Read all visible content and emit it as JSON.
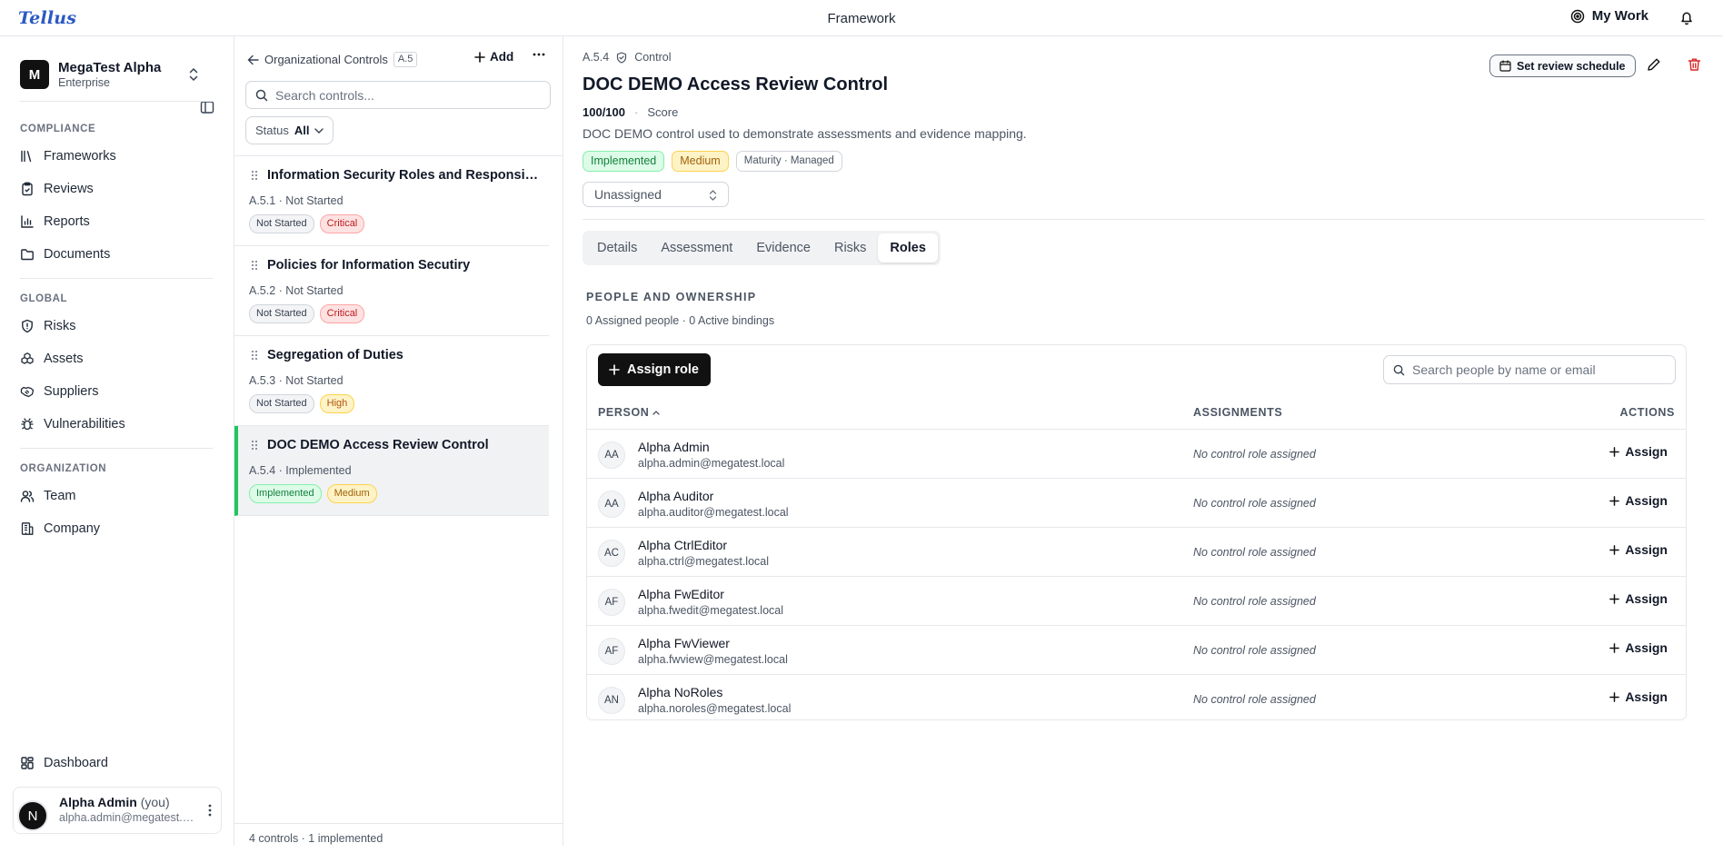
{
  "app": {
    "logo": "Tellus",
    "page_title": "Framework",
    "my_work_label": "My Work"
  },
  "sidebar": {
    "org_initial": "M",
    "org_name": "MegaTest Alpha",
    "org_plan": "Enterprise",
    "sections": [
      {
        "title": "COMPLIANCE",
        "items": [
          {
            "label": "Frameworks",
            "icon": "library-icon"
          },
          {
            "label": "Reviews",
            "icon": "clipboard-check-icon"
          },
          {
            "label": "Reports",
            "icon": "bar-chart-icon"
          },
          {
            "label": "Documents",
            "icon": "folder-icon"
          }
        ]
      },
      {
        "title": "GLOBAL",
        "items": [
          {
            "label": "Risks",
            "icon": "shield-alert-icon"
          },
          {
            "label": "Assets",
            "icon": "boxes-icon"
          },
          {
            "label": "Suppliers",
            "icon": "handshake-icon"
          },
          {
            "label": "Vulnerabilities",
            "icon": "bug-icon"
          }
        ]
      },
      {
        "title": "ORGANIZATION",
        "items": [
          {
            "label": "Team",
            "icon": "users-icon"
          },
          {
            "label": "Company",
            "icon": "building-icon"
          }
        ]
      }
    ],
    "dashboard_label": "Dashboard",
    "user": {
      "initial": "N",
      "name": "Alpha Admin",
      "you": "(you)",
      "email": "alpha.admin@megatest.local"
    }
  },
  "controls_list": {
    "back_label": "Organizational Controls",
    "code": "A.5",
    "add_label": "Add",
    "search_placeholder": "Search controls...",
    "status_label": "Status",
    "status_value": "All",
    "items": [
      {
        "title": "Information Security Roles and Responsibilities",
        "subtitle": "A.5.1 · Not Started",
        "badges": [
          {
            "text": "Not Started",
            "kind": "notstarted"
          },
          {
            "text": "Critical",
            "kind": "critical"
          }
        ],
        "active": false
      },
      {
        "title": "Policies for Information Secutiry",
        "subtitle": "A.5.2 · Not Started",
        "badges": [
          {
            "text": "Not Started",
            "kind": "notstarted"
          },
          {
            "text": "Critical",
            "kind": "critical"
          }
        ],
        "active": false
      },
      {
        "title": "Segregation of Duties",
        "subtitle": "A.5.3 · Not Started",
        "badges": [
          {
            "text": "Not Started",
            "kind": "notstarted"
          },
          {
            "text": "High",
            "kind": "high"
          }
        ],
        "active": false
      },
      {
        "title": "DOC DEMO Access Review Control",
        "subtitle": "A.5.4 · Implemented",
        "badges": [
          {
            "text": "Implemented",
            "kind": "implemented"
          },
          {
            "text": "Medium",
            "kind": "medium"
          }
        ],
        "active": true
      }
    ],
    "footer": "4 controls · 1 implemented"
  },
  "detail": {
    "code": "A.5.4",
    "type_label": "Control",
    "title": "DOC DEMO Access Review Control",
    "score_value": "100/100",
    "score_label": "Score",
    "description": "DOC DEMO control used to demonstrate assessments and evidence mapping.",
    "status_badge": "Implemented",
    "priority_badge": "Medium",
    "maturity_badge": "Maturity · Managed",
    "assignee": "Unassigned",
    "review_label": "Set review schedule",
    "tabs": [
      {
        "label": "Details",
        "active": false
      },
      {
        "label": "Assessment",
        "active": false
      },
      {
        "label": "Evidence",
        "active": false
      },
      {
        "label": "Risks",
        "active": false
      },
      {
        "label": "Roles",
        "active": true
      }
    ],
    "roles": {
      "section_title": "PEOPLE AND OWNERSHIP",
      "summary": "0 Assigned people · 0 Active bindings",
      "assign_role_label": "Assign role",
      "search_placeholder": "Search people by name or email",
      "columns": {
        "person": "PERSON",
        "assignments": "ASSIGNMENTS",
        "actions": "ACTIONS"
      },
      "people": [
        {
          "initials": "AA",
          "name": "Alpha Admin",
          "email": "alpha.admin@megatest.local",
          "assignment": "No control role assigned",
          "action": "Assign"
        },
        {
          "initials": "AA",
          "name": "Alpha Auditor",
          "email": "alpha.auditor@megatest.local",
          "assignment": "No control role assigned",
          "action": "Assign"
        },
        {
          "initials": "AC",
          "name": "Alpha CtrlEditor",
          "email": "alpha.ctrl@megatest.local",
          "assignment": "No control role assigned",
          "action": "Assign"
        },
        {
          "initials": "AF",
          "name": "Alpha FwEditor",
          "email": "alpha.fwedit@megatest.local",
          "assignment": "No control role assigned",
          "action": "Assign"
        },
        {
          "initials": "AF",
          "name": "Alpha FwViewer",
          "email": "alpha.fwview@megatest.local",
          "assignment": "No control role assigned",
          "action": "Assign"
        },
        {
          "initials": "AN",
          "name": "Alpha NoRoles",
          "email": "alpha.noroles@megatest.local",
          "assignment": "No control role assigned",
          "action": "Assign"
        }
      ]
    }
  },
  "colors": {
    "accent_green": "#22c55e",
    "brand_blue": "#2b59c3",
    "danger_red": "#dc2626"
  }
}
